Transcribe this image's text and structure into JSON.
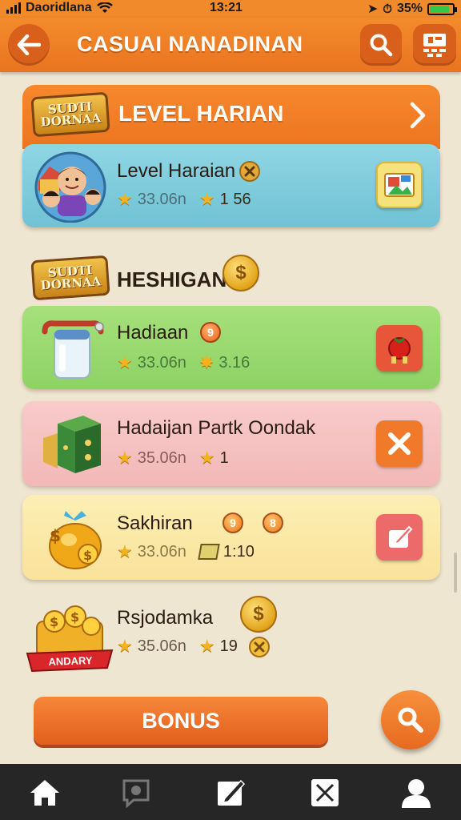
{
  "status_bar": {
    "carrier": "Daoridlana",
    "time": "13:21",
    "battery_text": "35%",
    "battery_level": 0.85
  },
  "header": {
    "title": "CASUAI NANADINAN",
    "back_icon": "arrow-left-icon",
    "search_icon": "search-icon",
    "menu_icon": "grid-menu-icon"
  },
  "section1": {
    "badge": "SUDTI DORNAA",
    "title": "LEVEL HARIAN",
    "chevron_icon": "chevron-right-icon",
    "card": {
      "title": "Level Haraian",
      "rating": "33.06n",
      "count": "1 56",
      "image_icon": "family-avatar-icon",
      "action_icon": "picture-icon"
    }
  },
  "section2": {
    "badge": "SUDTI DORNAA",
    "title": "HESHIGAN",
    "coin": "$",
    "cards": [
      {
        "title": "Hadiaan",
        "rating": "33.06n",
        "count": "3.16",
        "badge_text": "9",
        "image_icon": "jar-icon",
        "action_icon": "tomato-icon",
        "bg": "#9ddc72",
        "action_bg": "#e8563a"
      },
      {
        "title": "Hadaijan Partk Oondak",
        "rating": "35.06n",
        "count": "1",
        "image_icon": "cube-box-icon",
        "action_icon": "close-icon",
        "bg": "#f7c3c3",
        "action_bg": "#f07a2a"
      },
      {
        "title": "Sakhiran",
        "rating": "33.06n",
        "count": "1:10",
        "badge_text": "9",
        "badge_text_2": "8",
        "image_icon": "money-bag-icon",
        "action_icon": "edit-icon",
        "bg": "#fbe9a8",
        "action_bg": "#ec6a6a"
      }
    ],
    "reward": {
      "title": "Rsjodamka",
      "rating": "35.06n",
      "count": "19",
      "coin": "$",
      "ribbon": "ANDARY",
      "image_icon": "treasure-coins-icon"
    }
  },
  "bonus_label": "BONUS",
  "fab_icon": "search-icon",
  "nav": [
    "home-icon",
    "chat-icon",
    "edit-icon",
    "close-box-icon",
    "user-icon"
  ]
}
